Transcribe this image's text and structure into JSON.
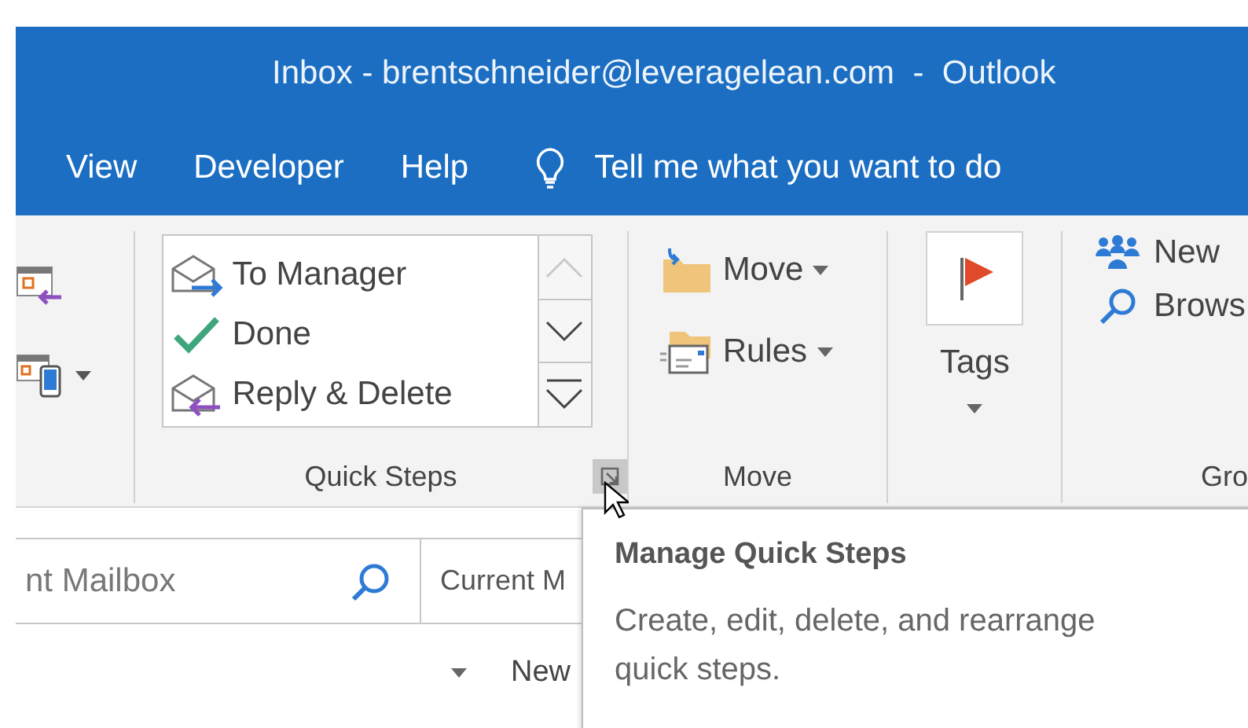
{
  "window": {
    "title": "Inbox - brentschneider@leveragelean.com  -  Outlook"
  },
  "tabs": [
    {
      "label": "View"
    },
    {
      "label": "Developer"
    },
    {
      "label": "Help"
    }
  ],
  "tell_me": {
    "placeholder": "Tell me what you want to do"
  },
  "quick_steps": {
    "label": "Quick Steps",
    "scroll_up_disabled": true,
    "items": [
      {
        "label": "To Manager",
        "kind": "forward"
      },
      {
        "label": "Done",
        "kind": "check"
      },
      {
        "label": "Reply & Delete",
        "kind": "reply"
      }
    ]
  },
  "move": {
    "label": "Move",
    "buttons": [
      {
        "label": "Move",
        "kind": "move"
      },
      {
        "label": "Rules",
        "kind": "rules"
      }
    ]
  },
  "tags": {
    "label": "Tags"
  },
  "groups": {
    "label": "Gro",
    "buttons": [
      {
        "label": "New",
        "kind": "people"
      },
      {
        "label": "Brows",
        "kind": "search"
      }
    ]
  },
  "search": {
    "placeholder": "nt Mailbox",
    "scope": "Current M"
  },
  "filter_row": {
    "new_label": "New"
  },
  "tooltip": {
    "title": "Manage Quick Steps",
    "text": "Create, edit, delete, and rearrange quick steps."
  }
}
